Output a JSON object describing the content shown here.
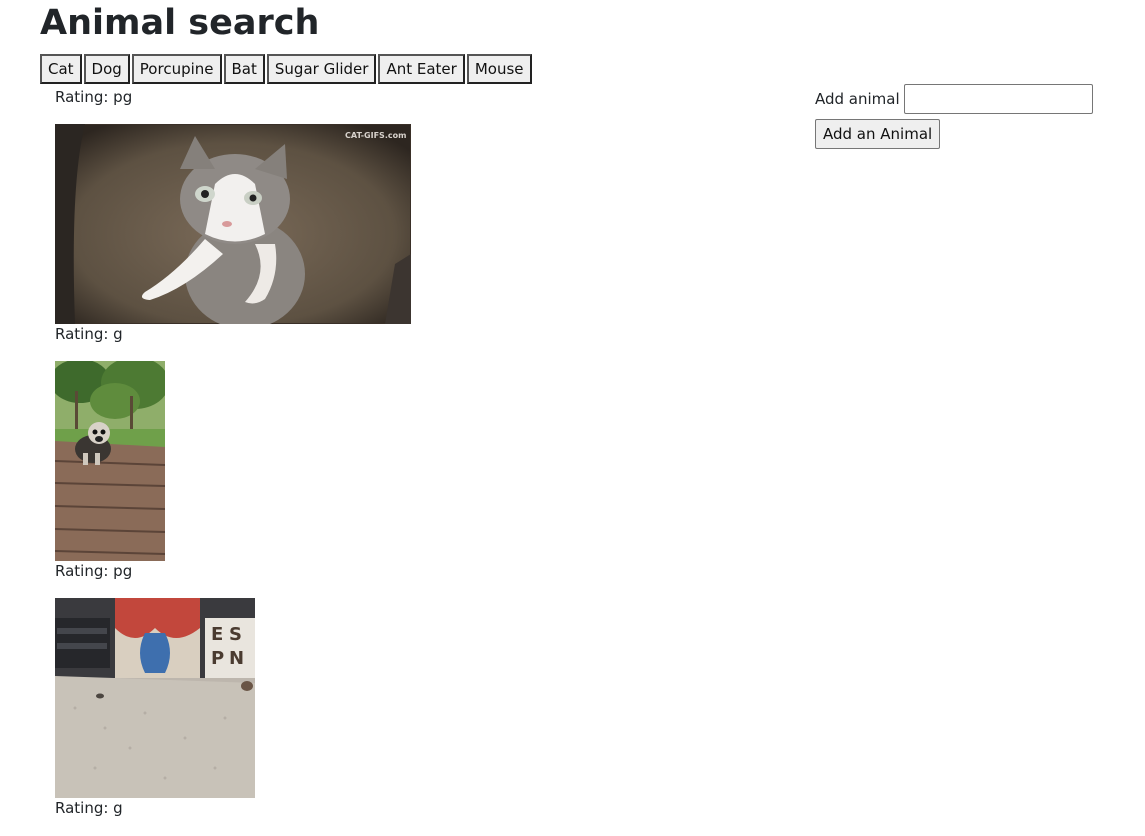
{
  "page": {
    "title": "Animal search"
  },
  "animal_buttons": [
    "Cat",
    "Dog",
    "Porcupine",
    "Bat",
    "Sugar Glider",
    "Ant Eater",
    "Mouse"
  ],
  "form": {
    "label": "Add animal",
    "input_value": "",
    "submit_label": "Add an Animal"
  },
  "gifs": [
    {
      "rating_label": "Rating: pg",
      "watermark": "CAT-GIFS.com"
    },
    {
      "rating_label": "Rating: g"
    },
    {
      "rating_label": "Rating: pg"
    }
  ],
  "trailing_rating": "Rating: g",
  "colors": {
    "text": "#212529",
    "button_bg": "#efefef"
  }
}
